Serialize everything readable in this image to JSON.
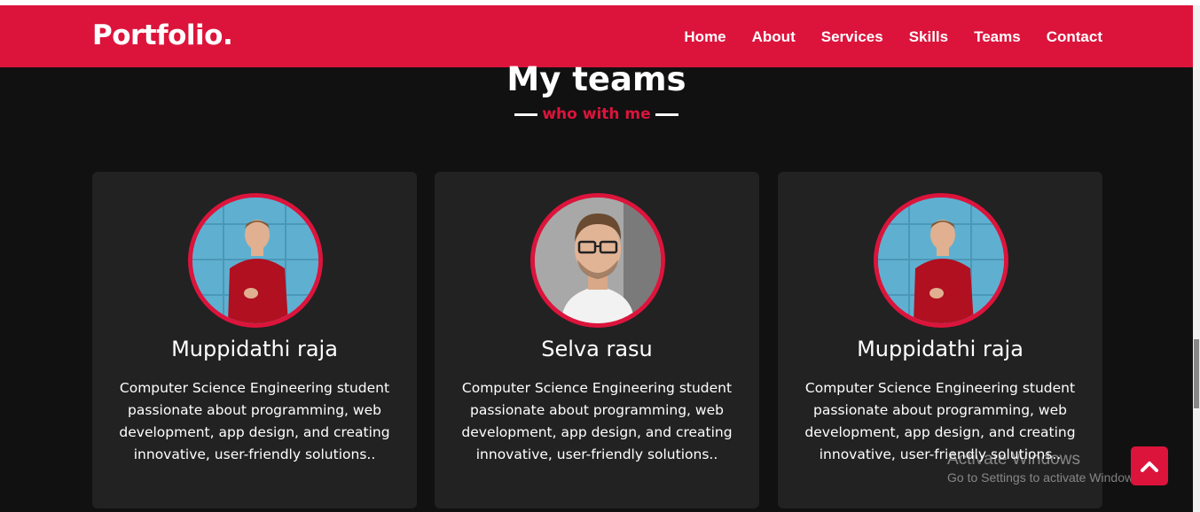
{
  "header": {
    "logo": "Portfolio.",
    "nav": [
      "Home",
      "About",
      "Services",
      "Skills",
      "Teams",
      "Contact"
    ]
  },
  "section": {
    "title": "My teams",
    "subtitle": "who with me"
  },
  "cards": [
    {
      "name": "Muppidathi raja",
      "description": "Computer Science Engineering student passionate about programming, web development, app design, and creating innovative, user-friendly solutions..",
      "photo": "man-red-sweater-photo"
    },
    {
      "name": "Selva rasu",
      "description": "Computer Science Engineering student passionate about programming, web development, app design, and creating innovative, user-friendly solutions..",
      "photo": "man-glasses-photo"
    },
    {
      "name": "Muppidathi raja",
      "description": "Computer Science Engineering student passionate about programming, web development, app design, and creating innovative, user-friendly solutions..",
      "photo": "man-red-sweater-photo"
    }
  ],
  "watermark": {
    "line1": "Activate Windows",
    "line2": "Go to Settings to activate Windows."
  },
  "scroll_top_icon": "chevron-up-icon",
  "colors": {
    "accent": "#dc143c",
    "background": "#111111",
    "card": "#222222"
  }
}
